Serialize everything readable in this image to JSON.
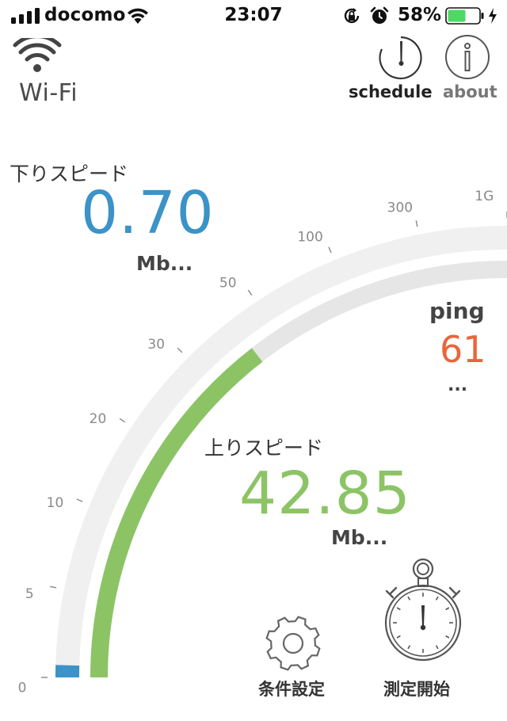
{
  "status_bar": {
    "carrier": "docomo",
    "time": "23:07",
    "battery_percent": "58%",
    "battery_level": 0.58,
    "icons": [
      "signal-icon",
      "wifi-icon",
      "orientation-lock-icon",
      "alarm-icon",
      "battery-icon",
      "charging-icon"
    ]
  },
  "header": {
    "connection_type": "Wi-Fi",
    "schedule_label": "schedule",
    "about_label": "about"
  },
  "download": {
    "label": "下りスピード",
    "value": "0.70",
    "unit": "Mb..."
  },
  "ping": {
    "label": "ping",
    "value": "61",
    "unit": "..."
  },
  "upload": {
    "label": "上りスピード",
    "value": "42.85",
    "unit": "Mb..."
  },
  "gauge": {
    "scale_labels": [
      "0",
      "5",
      "10",
      "20",
      "30",
      "50",
      "100",
      "300",
      "1G"
    ],
    "download_mbps": 0.7,
    "upload_mbps": 42.85
  },
  "buttons": {
    "settings_label": "条件設定",
    "start_label": "測定開始"
  },
  "colors": {
    "download": "#3b93c7",
    "upload": "#8cc465",
    "ping": "#e8663b",
    "track_outer": "#f0f0f0",
    "track_inner": "#e6e6e6",
    "battery_fill": "#4cd964"
  }
}
